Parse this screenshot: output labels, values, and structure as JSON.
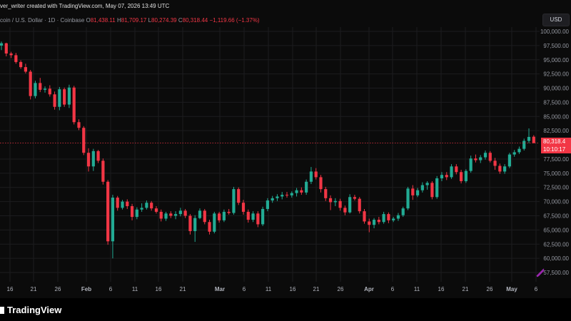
{
  "header": {
    "creator": "ver_writer created with TradingView.com, May 07, 2026 13:49 UTC",
    "symbol": "coin / U.S. Dollar · 1D · Coinbase",
    "o_label": "O",
    "o_value": "81,438.11",
    "h_label": "H",
    "h_value": "81,709.17",
    "l_label": "L",
    "l_value": "80,274.39",
    "c_label": "C",
    "c_value": "80,318.44",
    "change": "−1,119.66 (−1.37%)"
  },
  "currency_button": "USD",
  "last_price": {
    "value": "80,318.4",
    "countdown": "10:10:17"
  },
  "brand": "TradingView",
  "colors": {
    "up": "#22ab94",
    "down": "#f23645",
    "background": "#0b0b0b",
    "grid": "#1c1c1f",
    "axis_text": "#9598a1"
  },
  "chart_data": {
    "type": "candlestick",
    "y_ticks": [
      "100,000.00",
      "97,500.00",
      "95,000.00",
      "92,500.00",
      "90,000.00",
      "87,500.00",
      "85,000.00",
      "82,500.00",
      "77,500.00",
      "75,000.00",
      "72,500.00",
      "70,000.00",
      "67,500.00",
      "65,000.00",
      "62,500.00",
      "60,000.00",
      "57,500.00"
    ],
    "x_ticks": [
      "16",
      "21",
      "26",
      "Feb",
      "6",
      "11",
      "16",
      "21",
      "Mar",
      "6",
      "11",
      "16",
      "21",
      "26",
      "Apr",
      "6",
      "11",
      "16",
      "21",
      "26",
      "May",
      "6"
    ],
    "ylim": [
      56500,
      100500
    ],
    "last_price": 80318.4,
    "candles": [
      {
        "o": 97500,
        "h": 98200,
        "l": 96700,
        "c": 97900
      },
      {
        "o": 97900,
        "h": 98000,
        "l": 95600,
        "c": 96100
      },
      {
        "o": 96100,
        "h": 96400,
        "l": 95300,
        "c": 95800
      },
      {
        "o": 95800,
        "h": 96200,
        "l": 94300,
        "c": 94600
      },
      {
        "o": 94600,
        "h": 94900,
        "l": 93400,
        "c": 93700
      },
      {
        "o": 93700,
        "h": 94300,
        "l": 92600,
        "c": 92900
      },
      {
        "o": 92900,
        "h": 93200,
        "l": 88000,
        "c": 88600
      },
      {
        "o": 88600,
        "h": 91300,
        "l": 88200,
        "c": 90900
      },
      {
        "o": 90900,
        "h": 91800,
        "l": 89300,
        "c": 89700
      },
      {
        "o": 89700,
        "h": 90300,
        "l": 89200,
        "c": 89900
      },
      {
        "o": 89900,
        "h": 90500,
        "l": 88500,
        "c": 88900
      },
      {
        "o": 88900,
        "h": 89400,
        "l": 86200,
        "c": 86700
      },
      {
        "o": 86700,
        "h": 90200,
        "l": 86100,
        "c": 89800
      },
      {
        "o": 89800,
        "h": 90100,
        "l": 86700,
        "c": 87100
      },
      {
        "o": 87100,
        "h": 90600,
        "l": 86500,
        "c": 90100
      },
      {
        "o": 90100,
        "h": 90400,
        "l": 83600,
        "c": 84000
      },
      {
        "o": 84000,
        "h": 84500,
        "l": 82600,
        "c": 83000
      },
      {
        "o": 83000,
        "h": 83300,
        "l": 78200,
        "c": 78600
      },
      {
        "o": 78600,
        "h": 79400,
        "l": 75300,
        "c": 76200
      },
      {
        "o": 76200,
        "h": 79300,
        "l": 75400,
        "c": 78900
      },
      {
        "o": 78900,
        "h": 79100,
        "l": 76800,
        "c": 77200
      },
      {
        "o": 77200,
        "h": 77600,
        "l": 73000,
        "c": 73500
      },
      {
        "o": 73500,
        "h": 73800,
        "l": 62400,
        "c": 63000
      },
      {
        "o": 63000,
        "h": 71200,
        "l": 60000,
        "c": 70700
      },
      {
        "o": 70700,
        "h": 71000,
        "l": 68400,
        "c": 68900
      },
      {
        "o": 68900,
        "h": 70300,
        "l": 68600,
        "c": 70000
      },
      {
        "o": 70000,
        "h": 70400,
        "l": 68700,
        "c": 69200
      },
      {
        "o": 69200,
        "h": 69600,
        "l": 66700,
        "c": 67300
      },
      {
        "o": 67300,
        "h": 69000,
        "l": 66900,
        "c": 68600
      },
      {
        "o": 68600,
        "h": 69700,
        "l": 68200,
        "c": 68900
      },
      {
        "o": 68900,
        "h": 70200,
        "l": 68600,
        "c": 69800
      },
      {
        "o": 69800,
        "h": 70100,
        "l": 68400,
        "c": 68800
      },
      {
        "o": 68800,
        "h": 69200,
        "l": 67900,
        "c": 68200
      },
      {
        "o": 68200,
        "h": 68600,
        "l": 66500,
        "c": 67000
      },
      {
        "o": 67000,
        "h": 68200,
        "l": 66600,
        "c": 67900
      },
      {
        "o": 67900,
        "h": 68300,
        "l": 67100,
        "c": 67500
      },
      {
        "o": 67500,
        "h": 68300,
        "l": 66900,
        "c": 67800
      },
      {
        "o": 67800,
        "h": 68900,
        "l": 67400,
        "c": 68400
      },
      {
        "o": 68400,
        "h": 68700,
        "l": 67100,
        "c": 67500
      },
      {
        "o": 67500,
        "h": 67800,
        "l": 64200,
        "c": 64800
      },
      {
        "o": 64800,
        "h": 67600,
        "l": 62900,
        "c": 67100
      },
      {
        "o": 67100,
        "h": 68800,
        "l": 66900,
        "c": 68400
      },
      {
        "o": 68400,
        "h": 68700,
        "l": 66000,
        "c": 66400
      },
      {
        "o": 66400,
        "h": 66800,
        "l": 64200,
        "c": 64700
      },
      {
        "o": 64700,
        "h": 68200,
        "l": 64400,
        "c": 67900
      },
      {
        "o": 67900,
        "h": 68200,
        "l": 66300,
        "c": 66700
      },
      {
        "o": 66700,
        "h": 68600,
        "l": 66400,
        "c": 68200
      },
      {
        "o": 68200,
        "h": 68700,
        "l": 67700,
        "c": 68000
      },
      {
        "o": 68000,
        "h": 72600,
        "l": 67700,
        "c": 72200
      },
      {
        "o": 72200,
        "h": 72500,
        "l": 69400,
        "c": 69800
      },
      {
        "o": 69800,
        "h": 70300,
        "l": 67700,
        "c": 68200
      },
      {
        "o": 68200,
        "h": 68600,
        "l": 66300,
        "c": 66800
      },
      {
        "o": 66800,
        "h": 68300,
        "l": 66400,
        "c": 67900
      },
      {
        "o": 67900,
        "h": 68300,
        "l": 65500,
        "c": 66000
      },
      {
        "o": 66000,
        "h": 69100,
        "l": 65700,
        "c": 68700
      },
      {
        "o": 68700,
        "h": 70600,
        "l": 68300,
        "c": 70200
      },
      {
        "o": 70200,
        "h": 71000,
        "l": 69800,
        "c": 70600
      },
      {
        "o": 70600,
        "h": 71300,
        "l": 70100,
        "c": 70900
      },
      {
        "o": 70900,
        "h": 71700,
        "l": 70400,
        "c": 71200
      },
      {
        "o": 71200,
        "h": 71700,
        "l": 70700,
        "c": 71100
      },
      {
        "o": 71100,
        "h": 71800,
        "l": 70700,
        "c": 71500
      },
      {
        "o": 71500,
        "h": 72400,
        "l": 70900,
        "c": 72000
      },
      {
        "o": 72000,
        "h": 72500,
        "l": 71200,
        "c": 71600
      },
      {
        "o": 71600,
        "h": 73900,
        "l": 71200,
        "c": 73500
      },
      {
        "o": 73500,
        "h": 76100,
        "l": 73100,
        "c": 75300
      },
      {
        "o": 75300,
        "h": 75900,
        "l": 73900,
        "c": 74300
      },
      {
        "o": 74300,
        "h": 74700,
        "l": 71600,
        "c": 72200
      },
      {
        "o": 72200,
        "h": 72600,
        "l": 70100,
        "c": 70600
      },
      {
        "o": 70600,
        "h": 71100,
        "l": 68500,
        "c": 69900
      },
      {
        "o": 69900,
        "h": 70600,
        "l": 69200,
        "c": 70100
      },
      {
        "o": 70100,
        "h": 70500,
        "l": 68400,
        "c": 68900
      },
      {
        "o": 68900,
        "h": 69300,
        "l": 67600,
        "c": 68100
      },
      {
        "o": 68100,
        "h": 71300,
        "l": 67900,
        "c": 70800
      },
      {
        "o": 70800,
        "h": 71200,
        "l": 70200,
        "c": 70500
      },
      {
        "o": 70500,
        "h": 70800,
        "l": 67900,
        "c": 68300
      },
      {
        "o": 68300,
        "h": 68700,
        "l": 66100,
        "c": 66500
      },
      {
        "o": 66500,
        "h": 67000,
        "l": 64600,
        "c": 65900
      },
      {
        "o": 65900,
        "h": 67100,
        "l": 65300,
        "c": 66800
      },
      {
        "o": 66800,
        "h": 67300,
        "l": 66000,
        "c": 66400
      },
      {
        "o": 66400,
        "h": 68200,
        "l": 66100,
        "c": 67800
      },
      {
        "o": 67800,
        "h": 68100,
        "l": 66200,
        "c": 66700
      },
      {
        "o": 66700,
        "h": 67300,
        "l": 66400,
        "c": 67000
      },
      {
        "o": 67000,
        "h": 68000,
        "l": 66600,
        "c": 67600
      },
      {
        "o": 67600,
        "h": 69100,
        "l": 67300,
        "c": 68800
      },
      {
        "o": 68800,
        "h": 72600,
        "l": 68500,
        "c": 72300
      },
      {
        "o": 72300,
        "h": 72900,
        "l": 70300,
        "c": 71100
      },
      {
        "o": 71100,
        "h": 72400,
        "l": 70800,
        "c": 72000
      },
      {
        "o": 72000,
        "h": 73400,
        "l": 71600,
        "c": 72900
      },
      {
        "o": 72900,
        "h": 73600,
        "l": 72100,
        "c": 73300
      },
      {
        "o": 73300,
        "h": 73600,
        "l": 70400,
        "c": 70800
      },
      {
        "o": 70800,
        "h": 74500,
        "l": 70500,
        "c": 74100
      },
      {
        "o": 74100,
        "h": 75200,
        "l": 73600,
        "c": 74700
      },
      {
        "o": 74700,
        "h": 75200,
        "l": 73800,
        "c": 74300
      },
      {
        "o": 74300,
        "h": 76600,
        "l": 74000,
        "c": 76200
      },
      {
        "o": 76200,
        "h": 76600,
        "l": 74800,
        "c": 75200
      },
      {
        "o": 75200,
        "h": 75600,
        "l": 73200,
        "c": 73600
      },
      {
        "o": 73600,
        "h": 75700,
        "l": 73300,
        "c": 75400
      },
      {
        "o": 75400,
        "h": 78100,
        "l": 75100,
        "c": 77600
      },
      {
        "o": 77600,
        "h": 78300,
        "l": 76900,
        "c": 77300
      },
      {
        "o": 77300,
        "h": 78200,
        "l": 76800,
        "c": 77800
      },
      {
        "o": 77800,
        "h": 79000,
        "l": 77400,
        "c": 78600
      },
      {
        "o": 78600,
        "h": 78900,
        "l": 76900,
        "c": 77200
      },
      {
        "o": 77200,
        "h": 77700,
        "l": 75600,
        "c": 76300
      },
      {
        "o": 76300,
        "h": 76700,
        "l": 74900,
        "c": 75300
      },
      {
        "o": 75300,
        "h": 76600,
        "l": 74900,
        "c": 76200
      },
      {
        "o": 76200,
        "h": 78600,
        "l": 75900,
        "c": 78300
      },
      {
        "o": 78300,
        "h": 79100,
        "l": 77900,
        "c": 78700
      },
      {
        "o": 78700,
        "h": 79700,
        "l": 78400,
        "c": 79300
      },
      {
        "o": 79300,
        "h": 81100,
        "l": 79000,
        "c": 80700
      },
      {
        "o": 80700,
        "h": 82900,
        "l": 80300,
        "c": 81400
      },
      {
        "o": 81438,
        "h": 81709,
        "l": 80274,
        "c": 80318
      }
    ]
  }
}
